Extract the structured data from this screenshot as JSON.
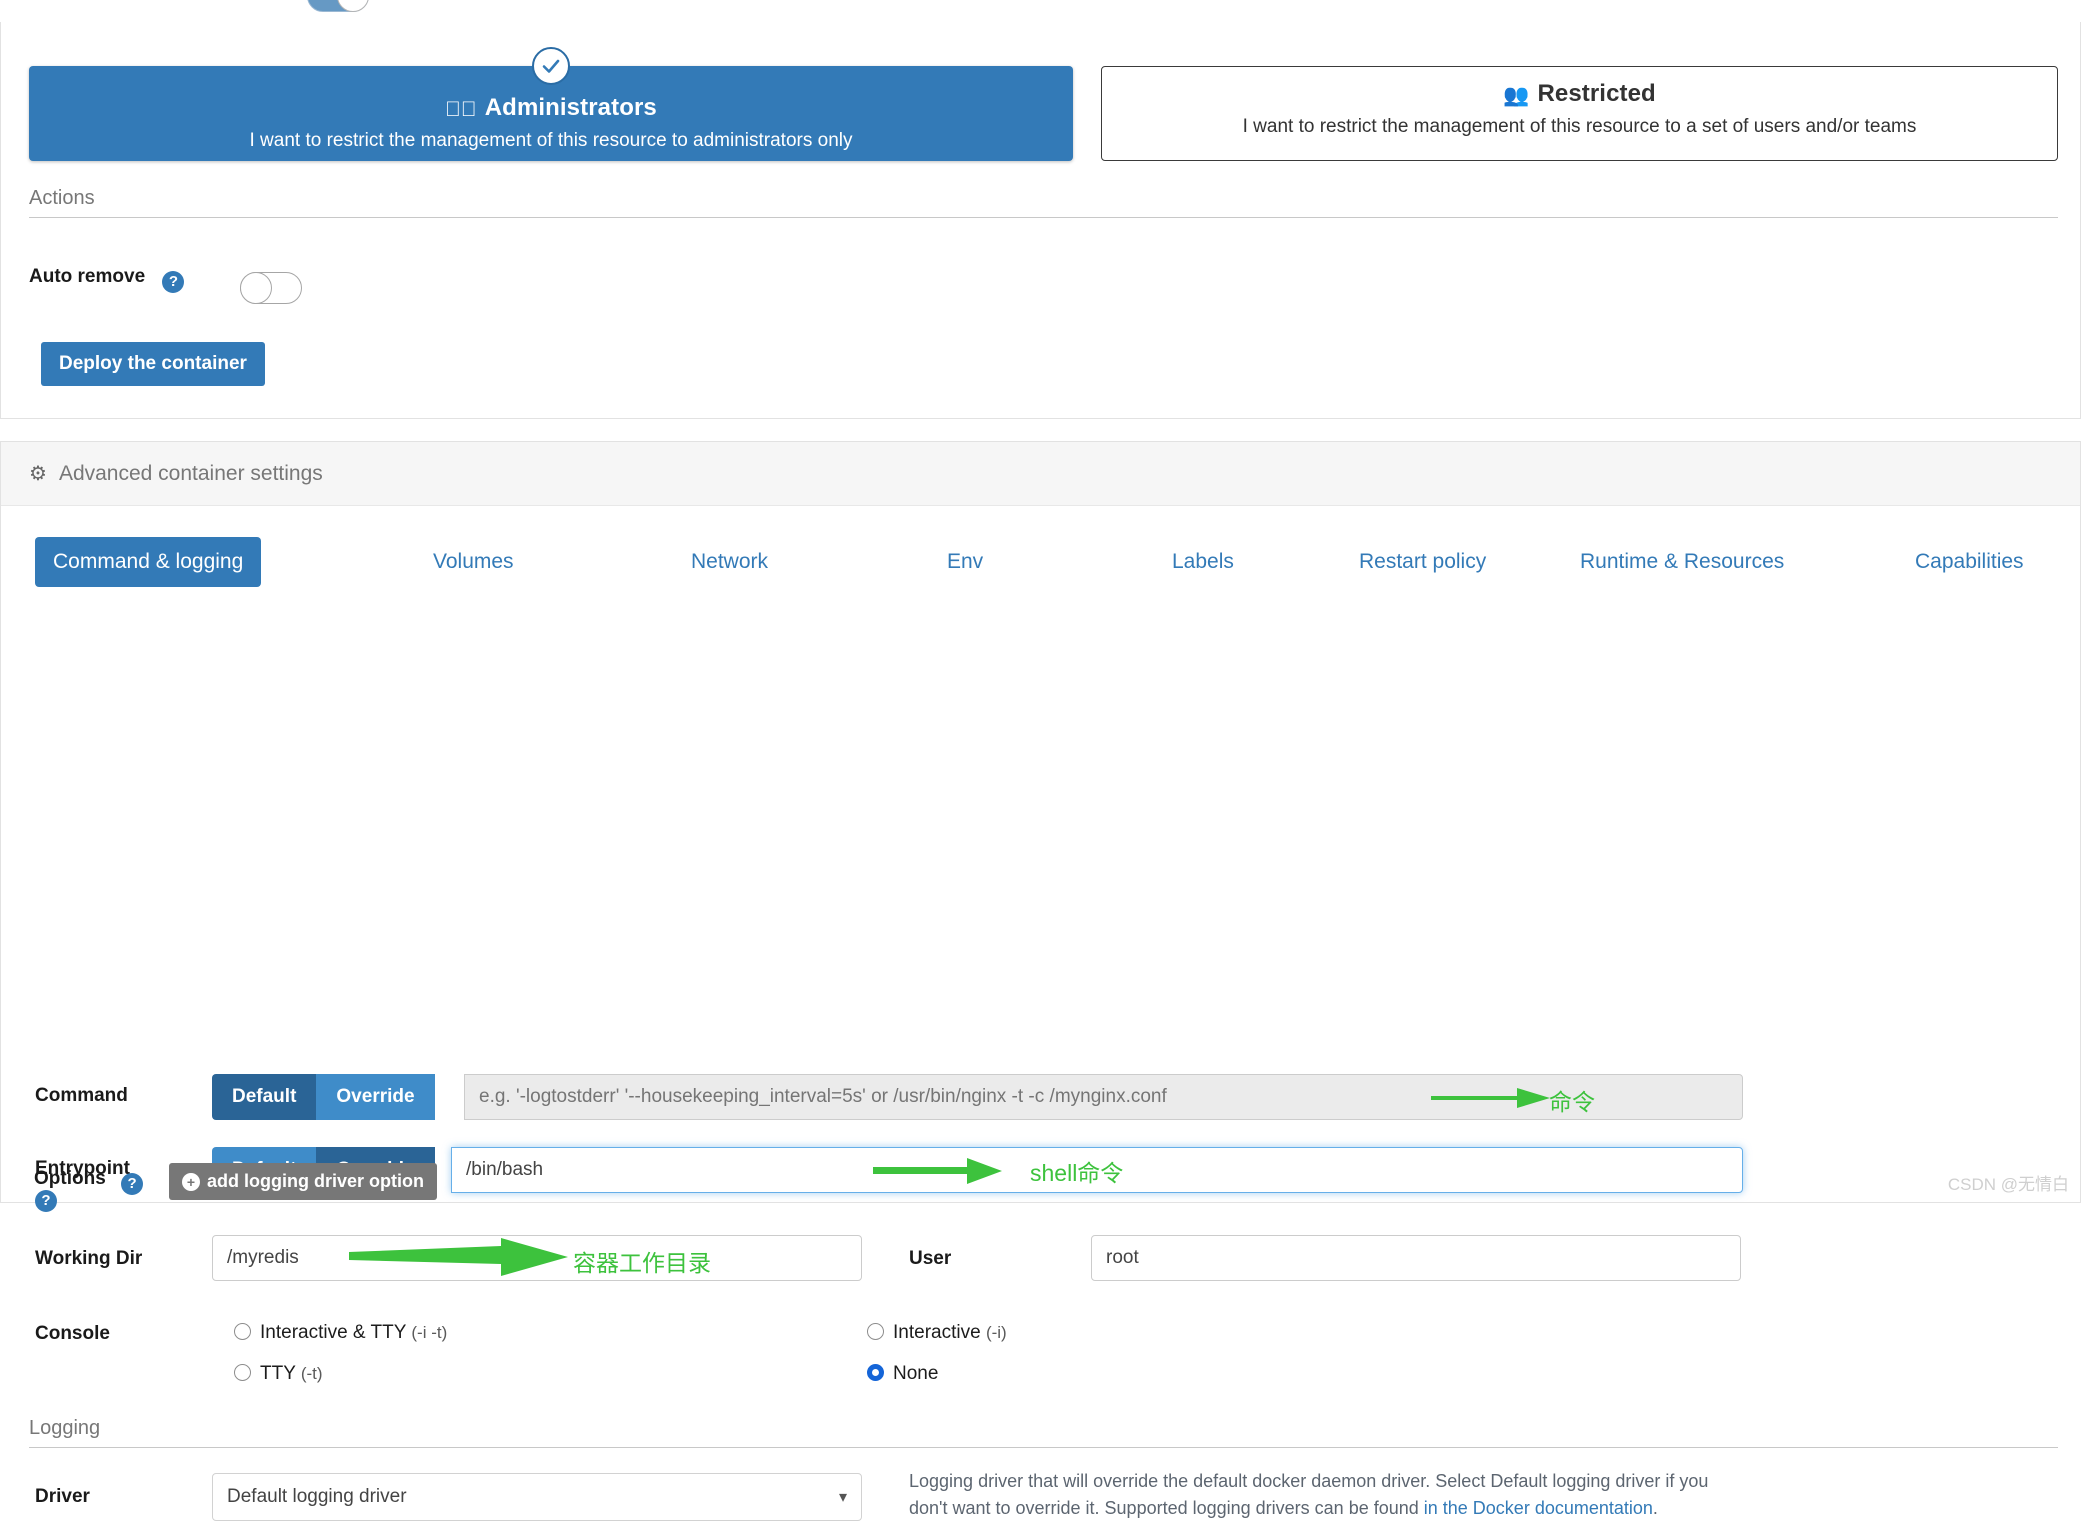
{
  "access_control": {
    "administrators": {
      "title": "Administrators",
      "icon": "eye-slash-icon",
      "subtitle": "I want to restrict the management of this resource to administrators only",
      "selected": true,
      "color": "#337ab7"
    },
    "restricted": {
      "title": "Restricted",
      "icon": "users-icon",
      "subtitle": "I want to restrict the management of this resource to a set of users and/or teams",
      "selected": false
    }
  },
  "actions": {
    "section_title": "Actions",
    "auto_remove_label": "Auto remove",
    "auto_remove_value": "off",
    "help_glyph": "?",
    "deploy_label": "Deploy the container"
  },
  "advanced": {
    "header": "Advanced container settings",
    "gear_icon": "gear-icon",
    "tabs": [
      {
        "label": "Command & logging",
        "active": true
      },
      {
        "label": "Volumes",
        "active": false
      },
      {
        "label": "Network",
        "active": false
      },
      {
        "label": "Env",
        "active": false
      },
      {
        "label": "Labels",
        "active": false
      },
      {
        "label": "Restart policy",
        "active": false
      },
      {
        "label": "Runtime & Resources",
        "active": false
      },
      {
        "label": "Capabilities",
        "active": false
      }
    ],
    "command": {
      "label": "Command",
      "default_label": "Default",
      "override_label": "Override",
      "selected": "Default",
      "placeholder": "e.g. '-logtostderr' '--housekeeping_interval=5s' or /usr/bin/nginx -t -c /mynginx.conf",
      "value": ""
    },
    "entrypoint": {
      "label": "Entrypoint",
      "default_label": "Default",
      "override_label": "Override",
      "selected": "Override",
      "value": "/bin/bash",
      "help_glyph": "?"
    },
    "working_dir": {
      "label": "Working Dir",
      "value": "/myredis"
    },
    "user": {
      "label": "User",
      "value": "root"
    },
    "console": {
      "label": "Console",
      "options": [
        {
          "label": "Interactive & TTY",
          "flags": "(-i -t)",
          "selected": false
        },
        {
          "label": "Interactive",
          "flags": "(-i)",
          "selected": false
        },
        {
          "label": "TTY",
          "flags": "(-t)",
          "selected": false
        },
        {
          "label": "None",
          "flags": "",
          "selected": true
        }
      ]
    },
    "logging": {
      "section_title": "Logging",
      "driver_label": "Driver",
      "driver_value": "Default logging driver",
      "driver_help_1": "Logging driver that will override the default docker daemon driver. Select Default logging driver if you don't want to override it. Supported logging drivers can be found ",
      "driver_help_link": "in the Docker documentation",
      "driver_help_2": ".",
      "options_label": "Options",
      "options_help_glyph": "?",
      "add_option_label": "add logging driver option",
      "add_option_icon": "plus-circle-icon"
    }
  },
  "annotations": [
    {
      "text": "命令",
      "color": "#3dc23d"
    },
    {
      "text": "shell命令",
      "color": "#3dc23d"
    },
    {
      "text": "容器工作目录",
      "color": "#3dc23d"
    }
  ],
  "watermark": "CSDN @无情白"
}
